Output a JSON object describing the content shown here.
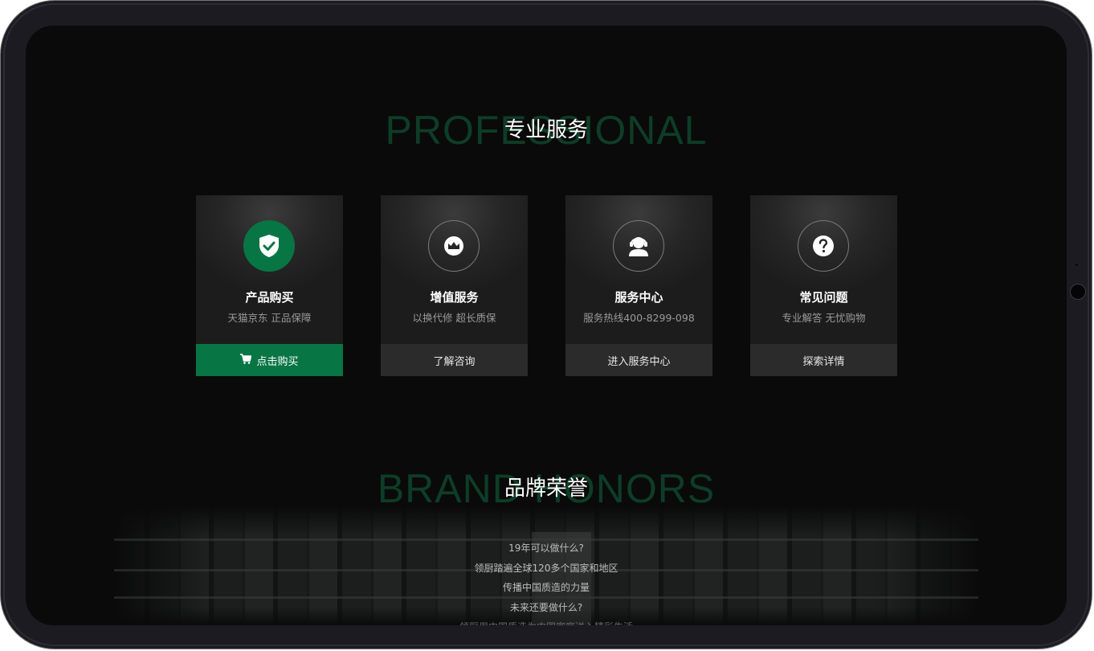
{
  "services": {
    "bg_word": "PROFESSIONAL",
    "title": "专业服务",
    "cards": [
      {
        "icon": "shield-check-icon",
        "title": "产品购买",
        "subtitle": "天猫京东 正品保障",
        "button": "点击购买",
        "button_icon": "cart-icon",
        "active": true
      },
      {
        "icon": "crown-icon",
        "title": "增值服务",
        "subtitle": "以换代修 超长质保",
        "button": "了解咨询",
        "active": false
      },
      {
        "icon": "headset-user-icon",
        "title": "服务中心",
        "subtitle": "服务热线400-8299-098",
        "button": "进入服务中心",
        "active": false
      },
      {
        "icon": "question-icon",
        "title": "常见问题",
        "subtitle": "专业解答 无忧购物",
        "button": "探索详情",
        "active": false
      }
    ]
  },
  "honors": {
    "bg_word": "BRAND HONORS",
    "title": "品牌荣誉",
    "lines": [
      "19年可以做什么?",
      "领厨踏遍全球120多个国家和地区",
      "传播中国质造的力量",
      "未来还要做什么?",
      "领厨用中国质造为中国家庭送入精彩生活"
    ]
  },
  "colors": {
    "accent": "#087545",
    "background": "#0a0a0a",
    "card": "#262626"
  }
}
